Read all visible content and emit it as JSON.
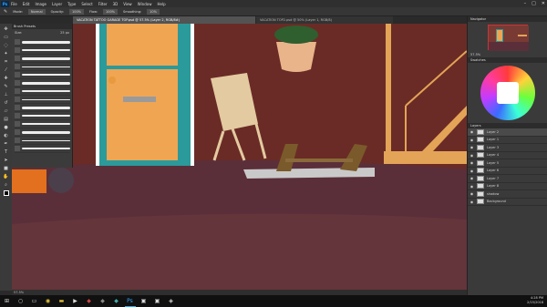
{
  "menubar": {
    "logo": "Ps",
    "items": [
      "File",
      "Edit",
      "Image",
      "Layer",
      "Type",
      "Select",
      "Filter",
      "3D",
      "View",
      "Window",
      "Help"
    ]
  },
  "options": {
    "mode_label": "Mode:",
    "mode_value": "Normal",
    "opacity_label": "Opacity:",
    "opacity_value": "100%",
    "flow_label": "Flow:",
    "flow_value": "100%",
    "smoothing_label": "Smoothing:",
    "smoothing_value": "10%"
  },
  "tabs": [
    {
      "label": "VACATION TATTOO GARAGE TOP.psd @ 57.5% (Layer 2, RGB/8#)",
      "active": true
    },
    {
      "label": "VACATION TOP2.psd @ 50% (Layer 1, RGB/8)",
      "active": false
    }
  ],
  "brush_panel": {
    "title": "Brush Presets",
    "size_label": "Size:",
    "size_value": "25 px"
  },
  "statusbar": {
    "text": "57.5%"
  },
  "navigator": {
    "title": "Navigator",
    "zoom": "57.5%"
  },
  "swatches": {
    "title": "Swatches"
  },
  "layers": {
    "title": "Layers",
    "rows": [
      {
        "name": "Layer 2",
        "selected": true
      },
      {
        "name": "Layer 1",
        "selected": false
      },
      {
        "name": "Layer 3",
        "selected": false
      },
      {
        "name": "Layer 4",
        "selected": false
      },
      {
        "name": "Layer 5",
        "selected": false
      },
      {
        "name": "Layer 6",
        "selected": false
      },
      {
        "name": "Layer 7",
        "selected": false
      },
      {
        "name": "Layer 8",
        "selected": false
      },
      {
        "name": "shadow",
        "selected": false
      },
      {
        "name": "Background",
        "selected": false
      }
    ]
  },
  "taskbar": {
    "time": "4:28 PM",
    "date": "2/15/2018"
  },
  "colors": {
    "wall": "#6a2b26",
    "floor": "#5a2f3a",
    "door": "#f0a553",
    "door_frame": "#2b9a9b",
    "stairs": "#e3a457"
  }
}
